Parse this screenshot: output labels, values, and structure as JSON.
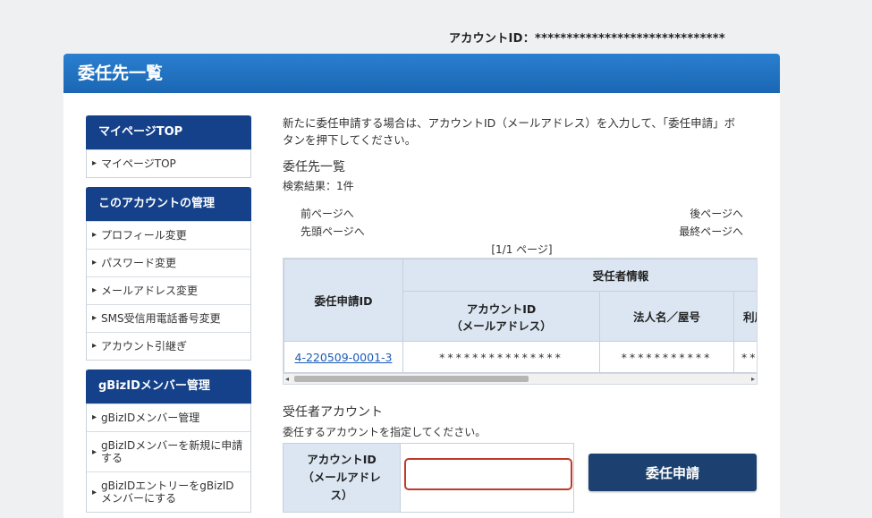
{
  "header": {
    "account_id_label": "アカウントID：",
    "account_id_value": "******************************"
  },
  "panel": {
    "title": "委任先一覧"
  },
  "sidebar": {
    "groups": [
      {
        "title": "マイページTOP",
        "items": [
          "マイページTOP"
        ]
      },
      {
        "title": "このアカウントの管理",
        "items": [
          "プロフィール変更",
          "パスワード変更",
          "メールアドレス変更",
          "SMS受信用電話番号変更",
          "アカウント引継ぎ"
        ]
      },
      {
        "title": "gBizIDメンバー管理",
        "items": [
          "gBizIDメンバー管理",
          "gBizIDメンバーを新規に申請する",
          "gBizIDエントリーをgBizIDメンバーにする"
        ]
      }
    ]
  },
  "main": {
    "intro_line1": "新たに委任申請する場合は、アカウントID（メールアドレス）を入力して、「委任申請」ボ",
    "intro_line2": "タンを押下してください。",
    "list_title": "委任先一覧",
    "result_count": "検索結果：1件",
    "pager": {
      "prev": "前ページへ",
      "first": "先頭ページへ",
      "next": "後ページへ",
      "last": "最終ページへ",
      "indicator": "[1/1 ページ]"
    },
    "table": {
      "col_request_id": "委任申請ID",
      "col_group_delegatee": "受任者情報",
      "col_account_id_line1": "アカウントID",
      "col_account_id_line2": "（メールアドレス）",
      "col_corp_name": "法人名／屋号",
      "col_partial": "利用",
      "rows": [
        {
          "request_id": "4-220509-0001-3",
          "account_id": "***************",
          "corp_name": "***********",
          "partial": "**"
        }
      ]
    },
    "delegate_title": "受任者アカウント",
    "delegate_sub": "委任するアカウントを指定してください。",
    "form": {
      "label_line1": "アカウントID",
      "label_line2": "（メールアドレ",
      "label_line3": "ス）",
      "input_value": "",
      "input_placeholder": ""
    },
    "submit_label": "委任申請"
  }
}
